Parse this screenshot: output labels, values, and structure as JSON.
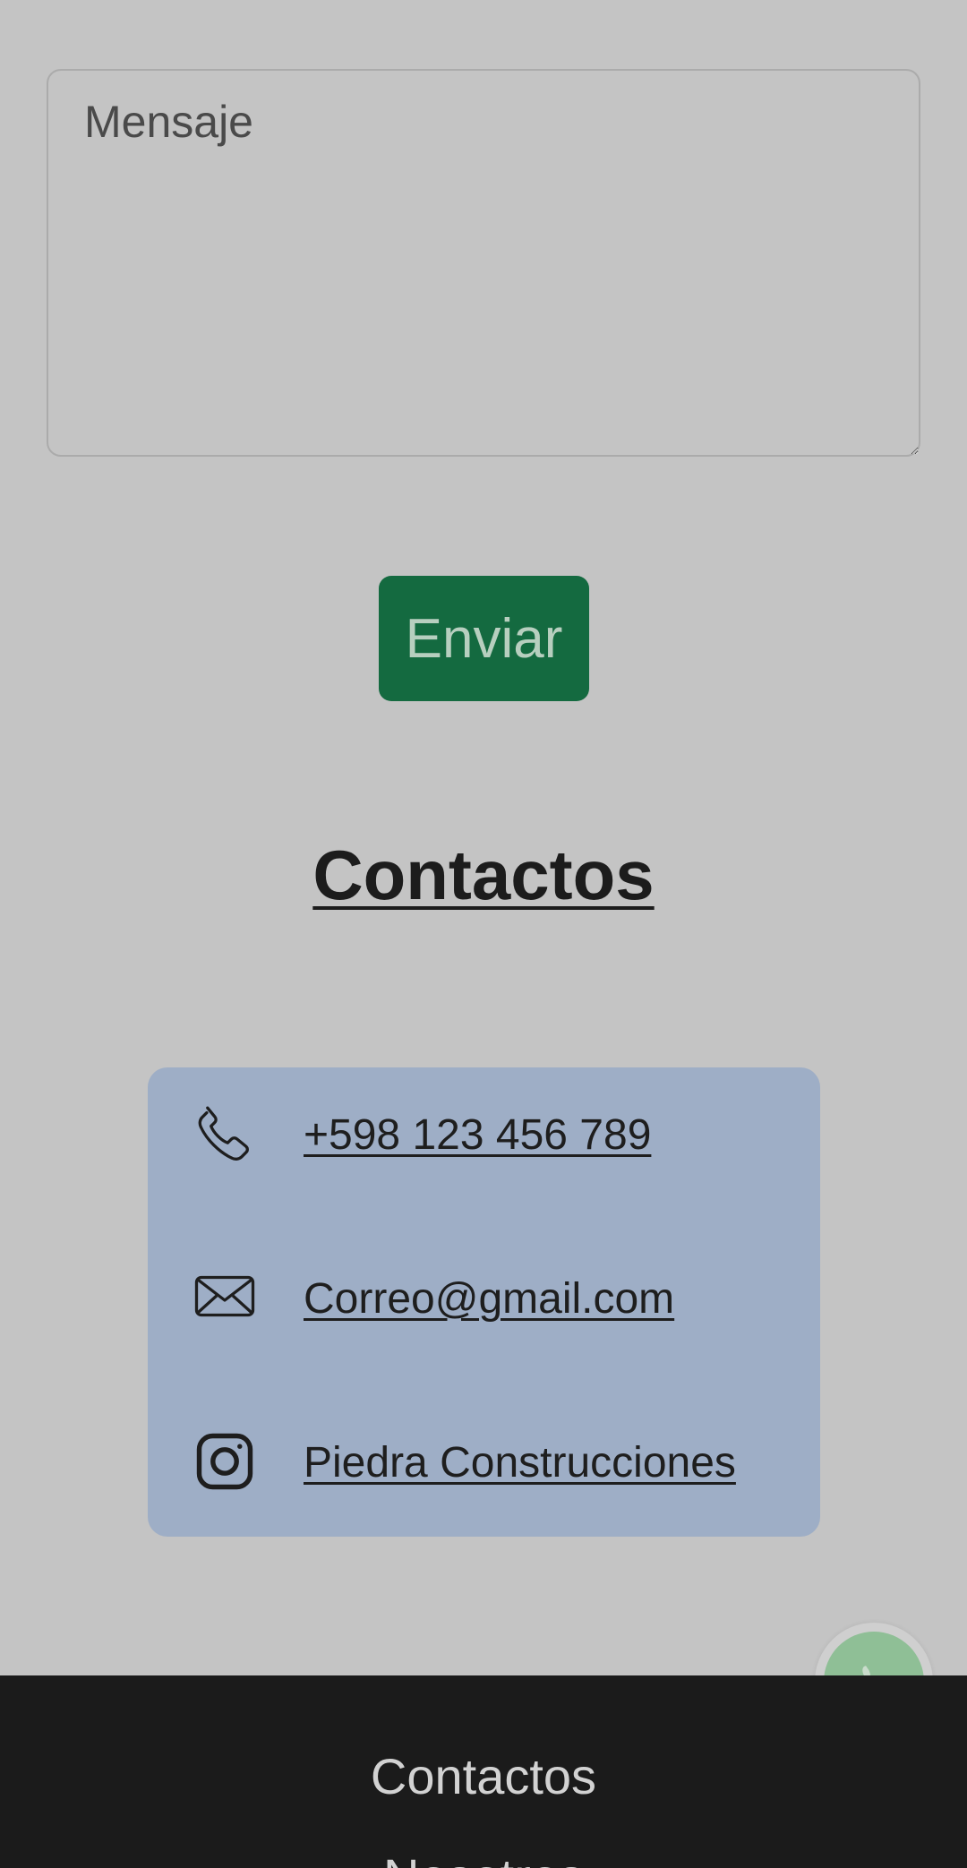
{
  "form": {
    "message_placeholder": "Mensaje",
    "send_label": "Enviar"
  },
  "contacts": {
    "title": "Contactos",
    "items": [
      {
        "icon": "phone-icon",
        "label": "+598 123 456 789"
      },
      {
        "icon": "mail-icon",
        "label": "Correo@gmail.com"
      },
      {
        "icon": "instagram-icon",
        "label": "Piedra Construcciones"
      }
    ]
  },
  "floating": {
    "icon": "whatsapp-icon"
  },
  "footer": {
    "links": [
      {
        "label": "Contactos"
      },
      {
        "label": "Nosotros"
      }
    ]
  },
  "colors": {
    "page_background": "#c4c4c4",
    "send_button": "#146a40",
    "contact_card": "#9eaec6",
    "footer_background": "#1b1b1b",
    "whatsapp_button": "#8fbf96"
  }
}
